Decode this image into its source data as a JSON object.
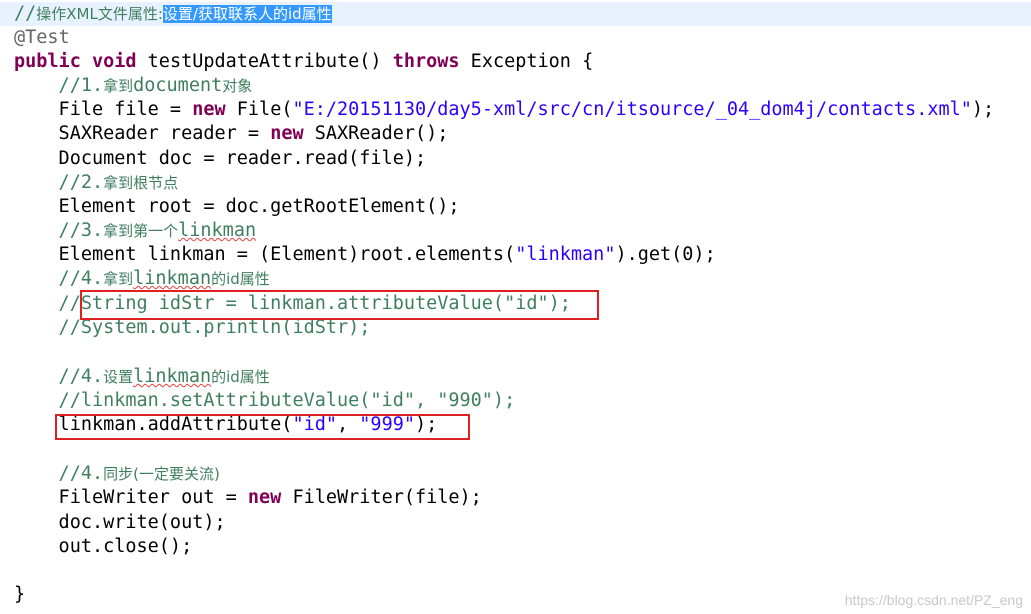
{
  "code": {
    "l0": {
      "prefix": "//",
      "cn": "操作XML文件属性:",
      "selected": "设置/获取联系人的id属性"
    },
    "l1": "@Test",
    "l2": {
      "kw1": "public",
      "kw2": "void",
      "rest": " testUpdateAttribute() ",
      "kw3": "throws",
      "tail": " Exception {"
    },
    "l3": {
      "prefix": "    //1.",
      "cn": "拿到",
      "word": "document",
      "cn2": "对象"
    },
    "l4": {
      "a": "    File file = ",
      "kw": "new",
      "b": " File(",
      "str": "\"E:/20151130/day5-xml/src/cn/itsource/_04_dom4j/contacts.xml\"",
      "c": ");"
    },
    "l5": {
      "a": "    SAXReader reader = ",
      "kw": "new",
      "b": " SAXReader();"
    },
    "l6": "    Document doc = reader.read(file);",
    "l7": {
      "prefix": "    //2.",
      "cn": "拿到根节点"
    },
    "l8": "    Element root = doc.getRootElement();",
    "l9": {
      "prefix": "    //3.",
      "cn": "拿到第一个",
      "word": "linkman"
    },
    "l10": {
      "a": "    Element linkman = (Element)root.elements(",
      "str": "\"linkman\"",
      "b": ").get(0);"
    },
    "l11": {
      "prefix": "    //4.",
      "cn": "拿到",
      "word": "linkman",
      "cn2": "的id属性"
    },
    "l12": {
      "prefix": "    //",
      "rest": "String idStr = linkman.attributeValue(\"id\");"
    },
    "l13": "    //System.out.println(idStr);",
    "l15": {
      "prefix": "    //4.",
      "cn": "设置",
      "word": "linkman",
      "cn2": "的id属性"
    },
    "l16": "    //linkman.setAttributeValue(\"id\", \"990\");",
    "l17": {
      "a": "    linkman.addAttribute(",
      "s1": "\"id\"",
      "sep": ", ",
      "s2": "\"999\"",
      "b": ");"
    },
    "l19": {
      "prefix": "    //4.",
      "cn": "同步(一定要关流)"
    },
    "l20": {
      "a": "    FileWriter out = ",
      "kw": "new",
      "b": " FileWriter(file);"
    },
    "l21": "    doc.write(out);",
    "l22": "    out.close();",
    "l24": "}"
  },
  "watermark": "https://blog.csdn.net/PZ_eng",
  "colors": {
    "keyword": "#7f0055",
    "string": "#2a00ff",
    "comment": "#3f7f5f",
    "annotation": "#646464",
    "current_line": "#e8f2fe",
    "selection": "#3399ff",
    "highlight_box": "#e02020"
  }
}
